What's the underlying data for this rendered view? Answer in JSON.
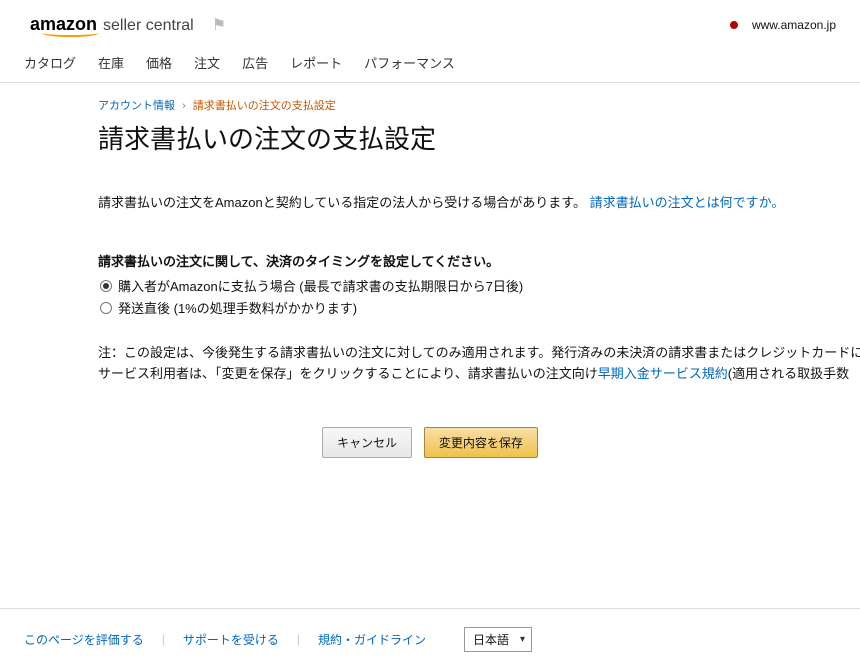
{
  "header": {
    "logo_main": "amazon",
    "logo_sub": "seller central",
    "domain": "www.amazon.jp"
  },
  "nav": {
    "items": [
      "カタログ",
      "在庫",
      "価格",
      "注文",
      "広告",
      "レポート",
      "パフォーマンス"
    ]
  },
  "breadcrumb": {
    "parent": "アカウント情報",
    "current": "請求書払いの注文の支払設定"
  },
  "page": {
    "title": "請求書払いの注文の支払設定",
    "intro_text": "請求書払いの注文をAmazonと契約している指定の法人から受ける場合があります。",
    "intro_link": "請求書払いの注文とは何ですか。",
    "section_heading": "請求書払いの注文に関して、決済のタイミングを設定してください。",
    "option1": "購入者がAmazonに支払う場合 (最長で請求書の支払期限日から7日後)",
    "option2": "発送直後 (1%の処理手数料がかかります)",
    "note_prefix": "注：この設定は、今後発生する請求書払いの注文に対してのみ適用されます。発行済みの未決済の請求書またはクレジットカードに",
    "note_line2a": "サービス利用者は、「変更を保存」をクリックすることにより、請求書払いの注文向け",
    "note_link": "早期入金サービス規約",
    "note_line2b": "(適用される取扱手数"
  },
  "buttons": {
    "cancel": "キャンセル",
    "save": "変更内容を保存"
  },
  "footer": {
    "rate": "このページを評価する",
    "support": "サポートを受ける",
    "terms": "規約・ガイドライン",
    "lang": "日本語"
  }
}
